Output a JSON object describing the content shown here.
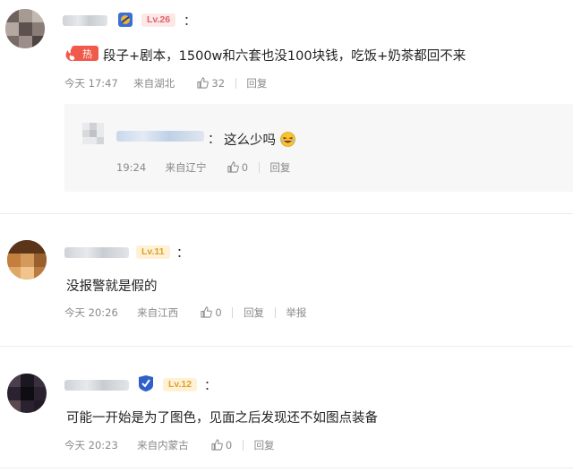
{
  "comments": [
    {
      "level": "Lv.26",
      "hot_label": "热",
      "text": "段子+剧本，1500w和六套也没100块钱，吃饭+奶茶都回不来",
      "time": "今天 17:47",
      "location": "来自湖北",
      "likes": "32",
      "reply_label": "回复",
      "reply": {
        "text": "这么少吗",
        "emoji": "laughing-emoji",
        "time": "19:24",
        "location": "来自辽宁",
        "likes": "0",
        "reply_label": "回复"
      }
    },
    {
      "level": "Lv.11",
      "text": "没报警就是假的",
      "time": "今天 20:26",
      "location": "来自江西",
      "likes": "0",
      "reply_label": "回复",
      "report_label": "举报"
    },
    {
      "level": "Lv.12",
      "text": "可能一开始是为了图色，见面之后发现还不如图点装备",
      "time": "今天 20:23",
      "location": "来自内蒙古",
      "likes": "0",
      "reply_label": "回复"
    }
  ],
  "colon": "：",
  "colors": {
    "lv26_bg": "#fde8e8",
    "lv26_fg": "#e0626a",
    "lv11_bg": "#fff1d6",
    "lv11_fg": "#e0a12a",
    "lv12_bg": "#fff1d6",
    "lv12_fg": "#e0a12a",
    "hot": "#f05a4a"
  }
}
